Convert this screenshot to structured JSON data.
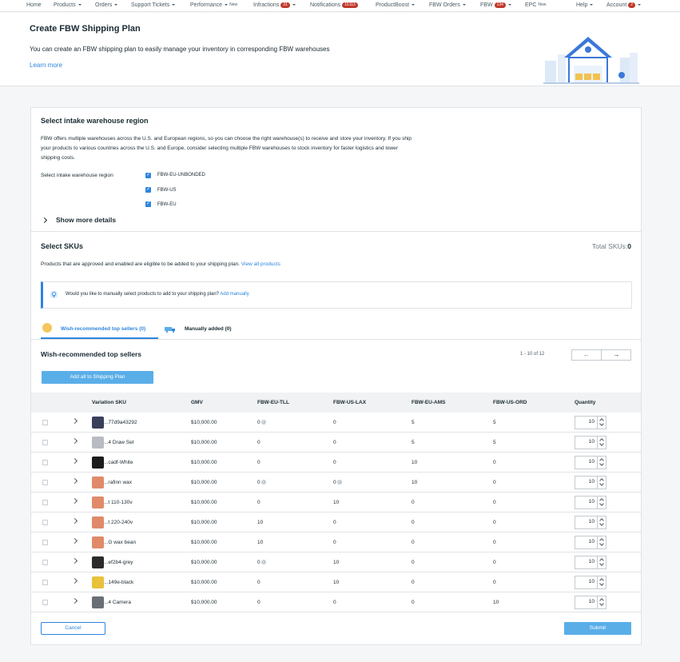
{
  "nav": {
    "items": [
      {
        "label": "Home",
        "caret": false,
        "badge": "",
        "tag": ""
      },
      {
        "label": "Products",
        "caret": true,
        "badge": "",
        "tag": ""
      },
      {
        "label": "Orders",
        "caret": true,
        "badge": "",
        "tag": ""
      },
      {
        "label": "Support Tickets",
        "caret": true,
        "badge": "",
        "tag": ""
      },
      {
        "label": "Performance",
        "caret": true,
        "badge": "",
        "tag": "New"
      },
      {
        "label": "Infractions",
        "caret": true,
        "badge": "31",
        "tag": ""
      },
      {
        "label": "Notifications",
        "caret": false,
        "badge": "15113",
        "tag": ""
      },
      {
        "label": "ProductBoost",
        "caret": true,
        "badge": "",
        "tag": ""
      },
      {
        "label": "FBW Orders",
        "caret": true,
        "badge": "",
        "tag": ""
      },
      {
        "label": "FBW",
        "caret": true,
        "badge": "134",
        "tag": ""
      },
      {
        "label": "EPC",
        "caret": false,
        "badge": "",
        "tag": "New"
      },
      {
        "label": "Help",
        "caret": true,
        "badge": "",
        "tag": ""
      },
      {
        "label": "Account",
        "caret": true,
        "badge": "2",
        "tag": ""
      }
    ]
  },
  "header": {
    "title": "Create FBW Shipping Plan",
    "description": "You can create an FBW shipping plan to easily manage your inventory in corresponding FBW warehouses",
    "learn_more": "Learn more"
  },
  "region": {
    "title": "Select intake warehouse region",
    "desc_lines": [
      "FBW offers multiple warehouses across the U.S. and European regions, so you can choose the right warehouse(s) to receive and store your inventory. If you ship",
      "your products to various countries across the U.S. and Europe, consider selecting multiple FBW warehouses to stock inventory for faster logistics and lower",
      "shipping costs."
    ],
    "field_label": "Select intake warehouse region",
    "options": [
      "FBW-EU-UNBONDED",
      "FBW-US",
      "FBW-EU"
    ],
    "show_more": "Show more details"
  },
  "skus": {
    "title": "Select SKUs",
    "total_label": "Total SKUs:",
    "total_value": "0",
    "desc": "Products that are approved and enabled are eligible to be added to your shipping plan.",
    "view_all": "View all products",
    "info_text": "Would you like to manually select products to add to your shipping plan?",
    "add_manually": "Add manually",
    "tab_recommended": "Wish-recommended top sellers (0)",
    "tab_manual": "Manually added (0)",
    "list_title": "Wish-recommended top sellers",
    "pagination": "1 - 10 of 12",
    "add_all": "Add all to Shipping Plan"
  },
  "table": {
    "headers": [
      "Variation SKU",
      "GMV",
      "FBW-EU-TLL",
      "FBW-US-LAX",
      "FBW-EU-AMS",
      "FBW-US-ORD",
      "Quantity"
    ],
    "rows": [
      {
        "sku": "...77d9a43292",
        "gmv": "$10,000.00",
        "tll": "0",
        "tll_info": true,
        "lax": "0",
        "lax_info": false,
        "ams": "5",
        "ord": "5",
        "qty": "10",
        "thumb": "#3a3f5c"
      },
      {
        "sku": "...4 Draw Set",
        "gmv": "$10,000.00",
        "tll": "0",
        "tll_info": false,
        "lax": "0",
        "lax_info": false,
        "ams": "5",
        "ord": "5",
        "qty": "10",
        "thumb": "#b8bcc2"
      },
      {
        "sku": "...cadf-White",
        "gmv": "$10,000.00",
        "tll": "0",
        "tll_info": false,
        "lax": "0",
        "lax_info": false,
        "ams": "10",
        "ord": "0",
        "qty": "10",
        "thumb": "#1c1c1c"
      },
      {
        "sku": "...rafinn wax",
        "gmv": "$10,000.00",
        "tll": "0",
        "tll_info": true,
        "lax": "0",
        "lax_info": true,
        "ams": "10",
        "ord": "0",
        "qty": "10",
        "thumb": "#e08a6a"
      },
      {
        "sku": "...t 110-130v",
        "gmv": "$10,000.00",
        "tll": "0",
        "tll_info": false,
        "lax": "10",
        "lax_info": false,
        "ams": "0",
        "ord": "0",
        "qty": "10",
        "thumb": "#e08a6a"
      },
      {
        "sku": "...t 220-240v",
        "gmv": "$10,000.00",
        "tll": "10",
        "tll_info": false,
        "lax": "0",
        "lax_info": false,
        "ams": "0",
        "ord": "0",
        "qty": "10",
        "thumb": "#e08a6a"
      },
      {
        "sku": "...G wax bean",
        "gmv": "$10,000.00",
        "tll": "10",
        "tll_info": false,
        "lax": "0",
        "lax_info": false,
        "ams": "0",
        "ord": "0",
        "qty": "10",
        "thumb": "#e08a6a"
      },
      {
        "sku": "...ef2b4-grey",
        "gmv": "$10,000.00",
        "tll": "0",
        "tll_info": true,
        "lax": "10",
        "lax_info": false,
        "ams": "0",
        "ord": "0",
        "qty": "10",
        "thumb": "#2b2b2b"
      },
      {
        "sku": "...149e-black",
        "gmv": "$10,000.00",
        "tll": "0",
        "tll_info": false,
        "lax": "10",
        "lax_info": false,
        "ams": "0",
        "ord": "0",
        "qty": "10",
        "thumb": "#e8c23a"
      },
      {
        "sku": "...4 Camera",
        "gmv": "$10,000.00",
        "tll": "0",
        "tll_info": false,
        "lax": "0",
        "lax_info": false,
        "ams": "0",
        "ord": "10",
        "qty": "10",
        "thumb": "#6a6f75"
      }
    ]
  },
  "footer": {
    "cancel": "Cancel",
    "submit": "Submit"
  },
  "colors": {
    "accent": "#2e86de",
    "button": "#5aaee8",
    "badge": "#c0392b"
  }
}
